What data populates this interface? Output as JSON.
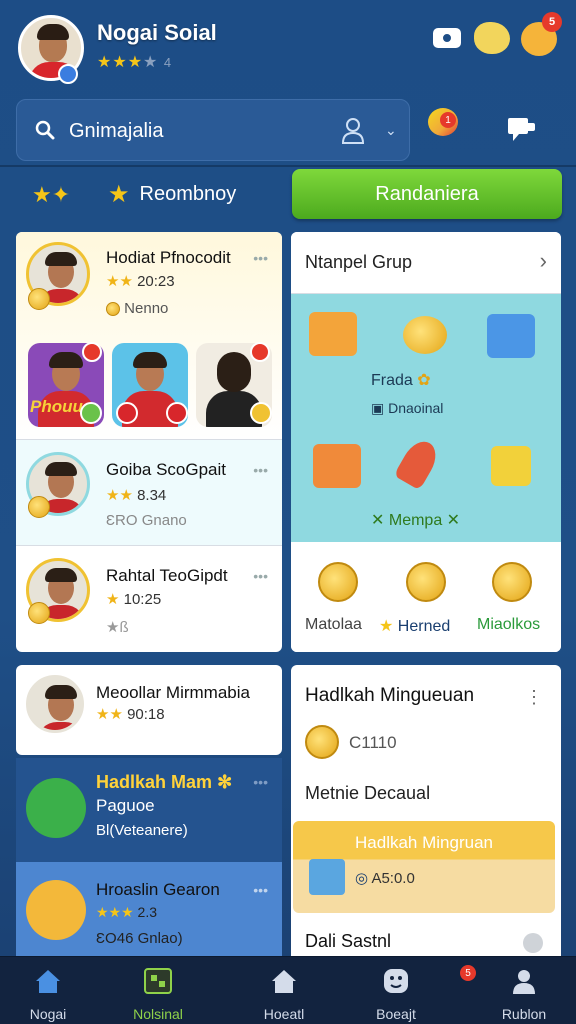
{
  "header": {
    "app_title": "Nogai Soial",
    "stars": "★★★",
    "stars_dim": "★",
    "rating_suffix": "4",
    "notif_badge": "5"
  },
  "search": {
    "value": "Gnimajalia",
    "ball_badge": "1"
  },
  "filter": {
    "stars": "★✦",
    "chip_star": "★",
    "chip_label": "Reombnoy",
    "action_button": "Randaniera"
  },
  "friends": [
    {
      "name": "Hodiat Pfnocodit",
      "stars": "★★",
      "time": "20:23",
      "tag": "Nenno"
    },
    {
      "name": "Goiba ScoGpait",
      "stars": "★★",
      "time": "8.34",
      "tag": "ƐRO Gnano"
    },
    {
      "name": "Rahtal TeoGipdt",
      "stars": "★",
      "time": "10:25",
      "tag": "★ß"
    }
  ],
  "tile_label": "Phouu",
  "shop": {
    "title": "Ntanpel Grup",
    "line1": "Frada",
    "line2": "Dnaoinal",
    "line3": "Mempa",
    "coins": [
      "Matolaa",
      "Herned",
      "Miaolkos"
    ]
  },
  "recent": {
    "name": "Meoollar Mirmmabia",
    "stars": "★★",
    "time": "90:18"
  },
  "games": [
    {
      "title": "Hadlkah Mam",
      "line2": "Paguoe",
      "line3": "Bl(Veteanere)"
    },
    {
      "title": "Hroaslin Gearon",
      "stars": "★★★",
      "time": "2.3",
      "line3": "ƐO46 Gnlao)"
    }
  ],
  "panel": {
    "title": "Hadlkah Mingueuan",
    "coin_value": "C1110",
    "subtitle": "Metnie Decaual",
    "promo_title": "Hadlkah Mingruan",
    "promo_value": "A5:0.0",
    "footer": "Dali Sastnl"
  },
  "nav": [
    {
      "label": "Nogai"
    },
    {
      "label": "Nolsinal"
    },
    {
      "label": "Hoeatl"
    },
    {
      "label": "Boeajt"
    },
    {
      "label": "Rublon"
    }
  ],
  "nav_badge": "5",
  "colors": {
    "accent_green": "#5cb82a",
    "bg_blue": "#1d4d86",
    "coin_gold": "#e3a414",
    "badge_red": "#e6392b"
  }
}
